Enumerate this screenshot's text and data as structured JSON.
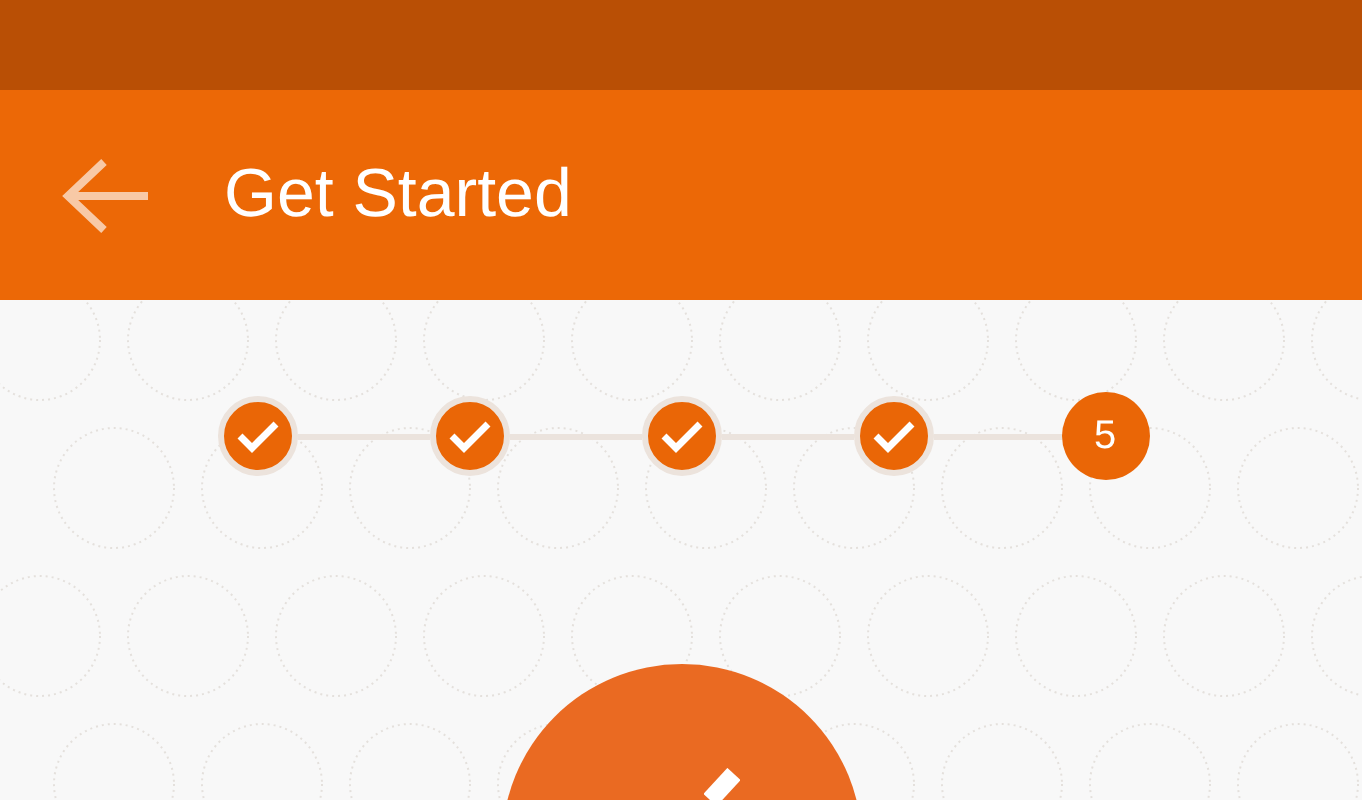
{
  "app_bar": {
    "title": "Get Started"
  },
  "steps": [
    {
      "completed": true
    },
    {
      "completed": true
    },
    {
      "completed": true
    },
    {
      "completed": true
    },
    {
      "completed": false,
      "label": "5"
    }
  ]
}
